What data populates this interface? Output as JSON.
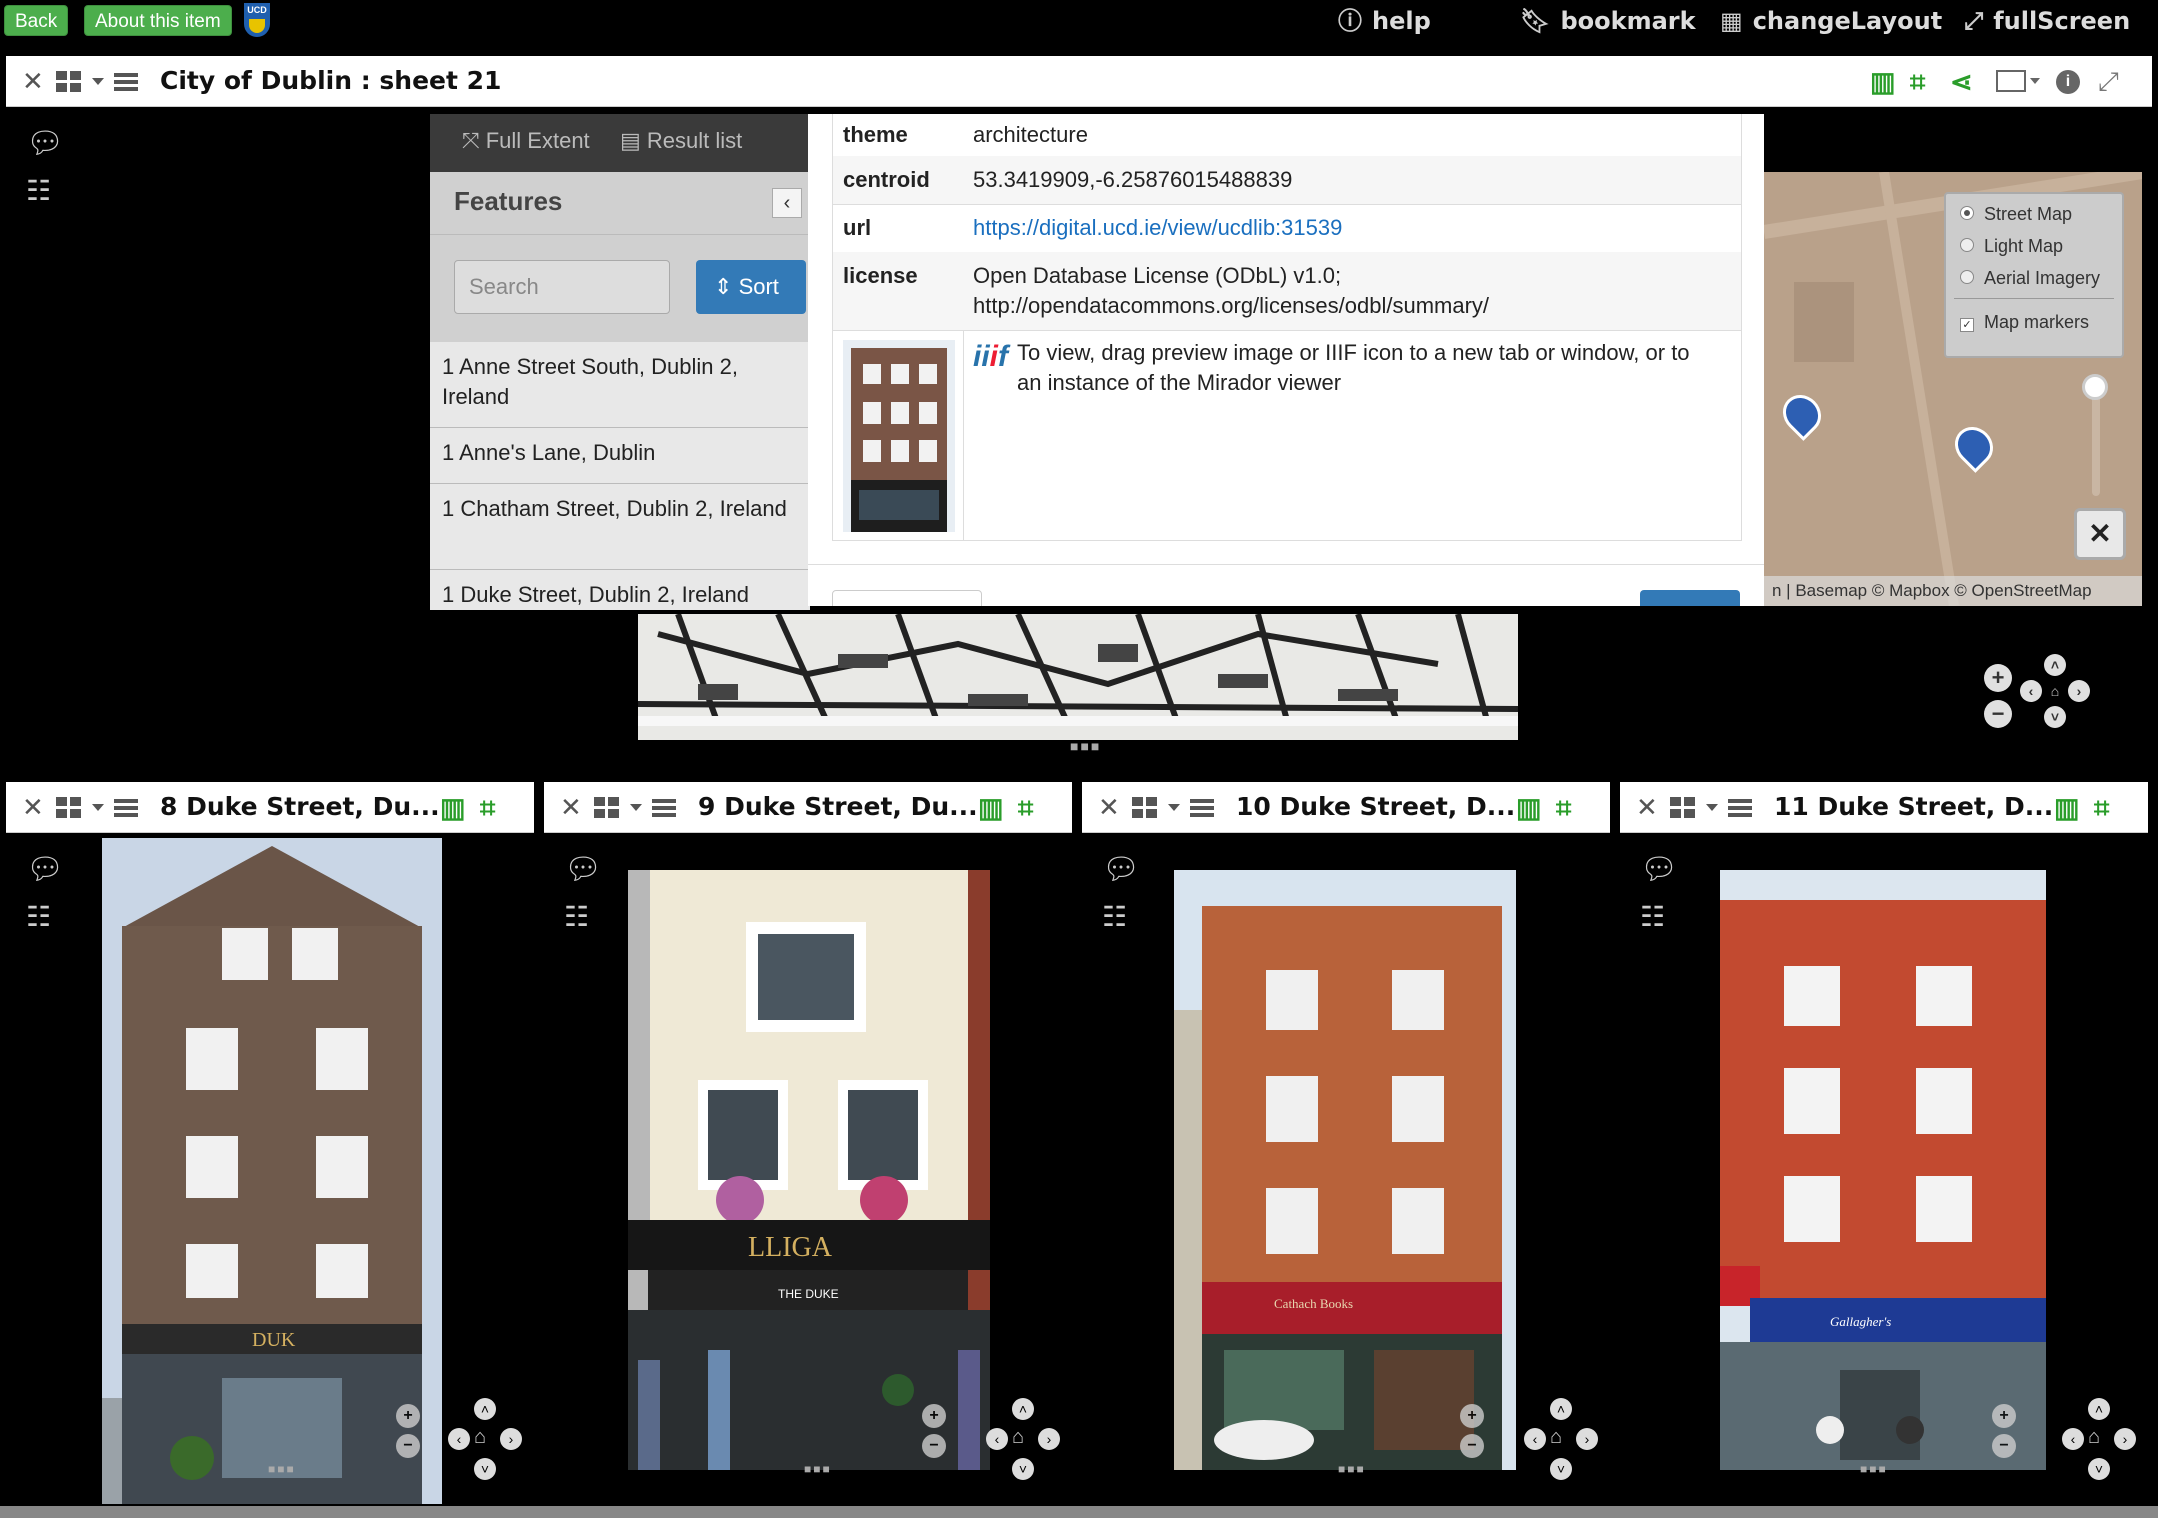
{
  "topbar": {
    "back_label": "Back",
    "about_label": "About this item",
    "logo_text": "UCD",
    "help_label": "help",
    "bookmark_label": "bookmark",
    "layout_label": "changeLayout",
    "fullscreen_label": "fullScreen"
  },
  "main_slot": {
    "title": "City of Dublin : sheet 21",
    "full_extent_label": "Full Extent",
    "result_list_label": "Result list",
    "features_title": "Features",
    "search_placeholder": "Search",
    "sort_label": "Sort",
    "features": [
      "1 Anne Street South, Dublin 2, Ireland",
      "1 Anne's Lane, Dublin",
      "1 Chatham Street, Dublin 2, Ireland",
      "1 Duke Street, Dublin 2, Ireland"
    ],
    "basemaps": {
      "street": "Street Map",
      "light": "Light Map",
      "aerial": "Aerial Imagery",
      "markers": "Map markers",
      "selected": "Street Map"
    },
    "attribution": "n | Basemap © Mapbox © OpenStreetMap"
  },
  "modal": {
    "rows": {
      "theme": {
        "key": "theme",
        "value": "architecture"
      },
      "centroid": {
        "key": "centroid",
        "value": "53.3419909,-6.25876015488839"
      },
      "url": {
        "key": "url",
        "value": "https://digital.ucd.ie/view/ucdlib:31539"
      },
      "license": {
        "key": "license",
        "value1": "Open Database License (ODbL) v1.0;",
        "value2": "http://opendatacommons.org/licenses/odbl/summary/"
      }
    },
    "iiif_text1": "To view, drag preview image or IIIF icon to a new tab or window, or to",
    "iiif_text2": "an instance of the Mirador viewer",
    "iiif_logo": "iiif"
  },
  "photo_slots": [
    {
      "title": "8 Duke Street, Du..."
    },
    {
      "title": "9 Duke Street, Du..."
    },
    {
      "title": "10 Duke Street, D..."
    },
    {
      "title": "11 Duke Street, D..."
    }
  ],
  "shop_signs": {
    "slot2": "LLIGA",
    "slot2_awning": "THE DUKE",
    "slot3": "Cathach Books",
    "slot4": "Gallagher's"
  },
  "colors": {
    "green": "#4cae4c",
    "icon_green": "#2a9d2a",
    "sort_blue": "#337ab7",
    "link": "#1a6fbf"
  }
}
